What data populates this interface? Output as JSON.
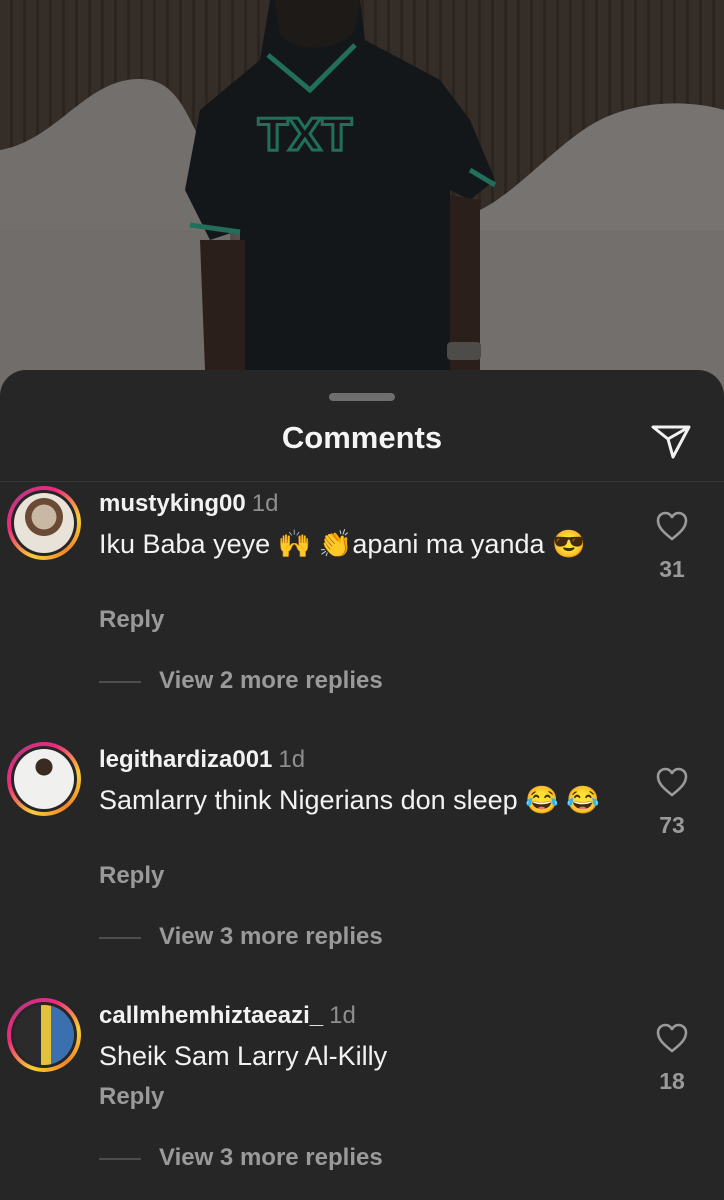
{
  "sheet": {
    "title": "Comments",
    "share_icon": "send-icon"
  },
  "comments": [
    {
      "username": "mustyking00",
      "time": "1d",
      "text": "Iku Baba yeye 🙌 👏apani ma yanda 😎",
      "reply_label": "Reply",
      "view_replies": "View 2 more replies",
      "likes": "31"
    },
    {
      "username": "legithardiza001",
      "time": "1d",
      "text": "Samlarry think Nigerians don sleep 😂 😂",
      "reply_label": "Reply",
      "view_replies": "View 3 more replies",
      "likes": "73"
    },
    {
      "username": "callmhemhiztaeazi_",
      "time": "1d",
      "text": "Sheik Sam Larry Al-Killy",
      "reply_label": "Reply",
      "view_replies": "View 3 more replies",
      "likes": "18"
    }
  ],
  "colors": {
    "background": "#262626",
    "text": "#f2f2f2",
    "muted": "#9a9a9a",
    "story_ring": [
      "#f9ce34",
      "#ee2a7b",
      "#c13584"
    ]
  }
}
